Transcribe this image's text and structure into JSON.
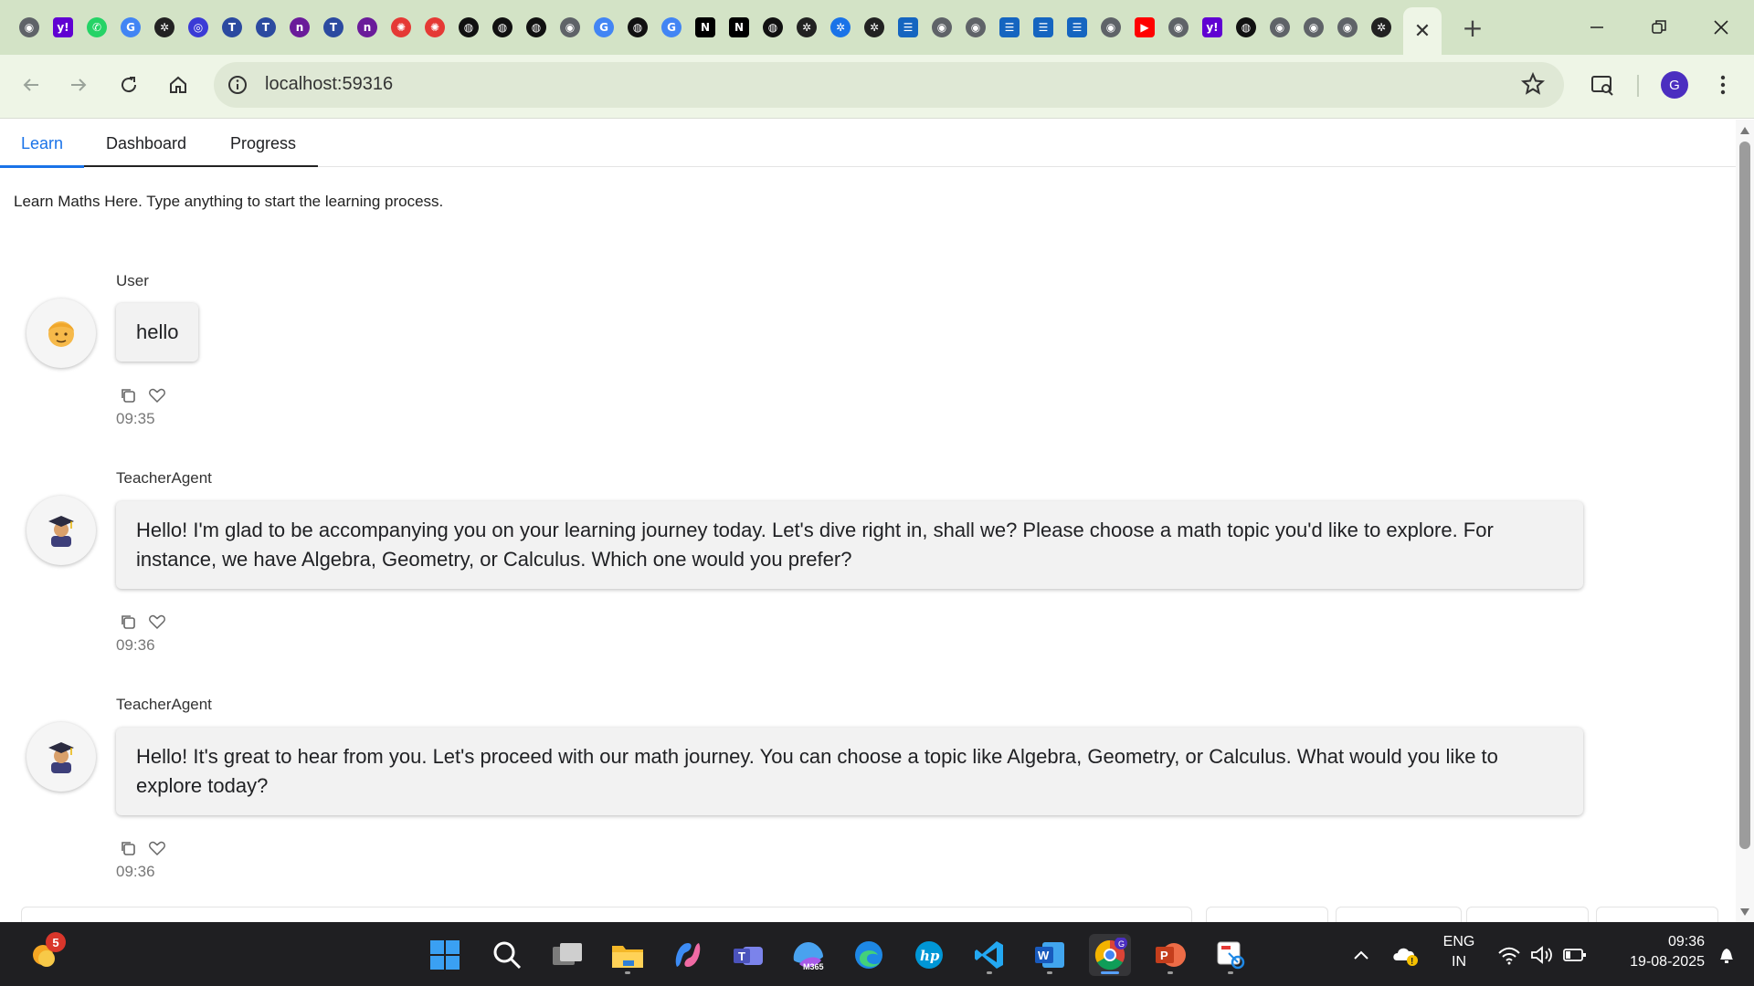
{
  "browser": {
    "url": "localhost:59316",
    "profile_initial": "G",
    "favicons": [
      {
        "icon": "chromium-icon",
        "color": "#5f6368",
        "glyph": "◉"
      },
      {
        "icon": "yahoo-icon",
        "color": "#6001d2",
        "glyph": "y!"
      },
      {
        "icon": "whatsapp-icon",
        "color": "#25d366",
        "glyph": "✆"
      },
      {
        "icon": "google-icon",
        "color": "#4285f4",
        "glyph": "G"
      },
      {
        "icon": "openai-icon",
        "color": "#222222",
        "glyph": "✲"
      },
      {
        "icon": "circle-icon",
        "color": "#3b3bd6",
        "glyph": "◎"
      },
      {
        "icon": "triv-icon",
        "color": "#2b4aa0",
        "glyph": "T"
      },
      {
        "icon": "triv-icon",
        "color": "#2b4aa0",
        "glyph": "T"
      },
      {
        "icon": "tn-icon",
        "color": "#6a1b9a",
        "glyph": "n"
      },
      {
        "icon": "triv-icon",
        "color": "#2b4aa0",
        "glyph": "T"
      },
      {
        "icon": "tn-icon",
        "color": "#6a1b9a",
        "glyph": "n"
      },
      {
        "icon": "asterisk-icon",
        "color": "#e53935",
        "glyph": "✺"
      },
      {
        "icon": "asterisk-icon",
        "color": "#e53935",
        "glyph": "✺"
      },
      {
        "icon": "github-icon",
        "color": "#111111",
        "glyph": "◍"
      },
      {
        "icon": "github-icon",
        "color": "#111111",
        "glyph": "◍"
      },
      {
        "icon": "github-icon",
        "color": "#111111",
        "glyph": "◍"
      },
      {
        "icon": "chromium-icon",
        "color": "#5f6368",
        "glyph": "◉"
      },
      {
        "icon": "google-icon",
        "color": "#4285f4",
        "glyph": "G"
      },
      {
        "icon": "github-icon",
        "color": "#111111",
        "glyph": "◍"
      },
      {
        "icon": "google-icon",
        "color": "#4285f4",
        "glyph": "G"
      },
      {
        "icon": "notion-icon",
        "color": "#000000",
        "glyph": "N"
      },
      {
        "icon": "notion-icon",
        "color": "#000000",
        "glyph": "N"
      },
      {
        "icon": "github-icon",
        "color": "#111111",
        "glyph": "◍"
      },
      {
        "icon": "openai-icon",
        "color": "#222222",
        "glyph": "✲"
      },
      {
        "icon": "openai-icon",
        "color": "#1a73e8",
        "glyph": "✲"
      },
      {
        "icon": "openai-icon",
        "color": "#222222",
        "glyph": "✲"
      },
      {
        "icon": "forms-icon",
        "color": "#1565c0",
        "glyph": "☰"
      },
      {
        "icon": "chromium-icon",
        "color": "#5f6368",
        "glyph": "◉"
      },
      {
        "icon": "chromium-icon",
        "color": "#5f6368",
        "glyph": "◉"
      },
      {
        "icon": "forms-icon",
        "color": "#1565c0",
        "glyph": "☰"
      },
      {
        "icon": "forms-icon",
        "color": "#1565c0",
        "glyph": "☰"
      },
      {
        "icon": "forms-icon",
        "color": "#1565c0",
        "glyph": "☰"
      },
      {
        "icon": "chromium-icon",
        "color": "#5f6368",
        "glyph": "◉"
      },
      {
        "icon": "youtube-icon",
        "color": "#ff0000",
        "glyph": "▶"
      },
      {
        "icon": "chromium-icon",
        "color": "#5f6368",
        "glyph": "◉"
      },
      {
        "icon": "yahoo-icon",
        "color": "#6001d2",
        "glyph": "y!"
      },
      {
        "icon": "github-icon",
        "color": "#111111",
        "glyph": "◍"
      },
      {
        "icon": "chromium-icon",
        "color": "#5f6368",
        "glyph": "◉"
      },
      {
        "icon": "chromium-icon",
        "color": "#5f6368",
        "glyph": "◉"
      },
      {
        "icon": "chromium-icon",
        "color": "#5f6368",
        "glyph": "◉"
      },
      {
        "icon": "openai-icon",
        "color": "#222222",
        "glyph": "✲"
      }
    ]
  },
  "app": {
    "tabs": [
      {
        "label": "Learn",
        "active": true
      },
      {
        "label": "Dashboard",
        "active": false
      },
      {
        "label": "Progress",
        "active": false
      }
    ],
    "intro": "Learn Maths Here. Type anything to start the learning process.",
    "accent_color": "#1a73e8"
  },
  "messages": [
    {
      "author": "User",
      "text": "hello",
      "time": "09:35",
      "avatar_icon": "user-face-icon"
    },
    {
      "author": "TeacherAgent",
      "text": "Hello! I'm glad to be accompanying you on your learning journey today. Let's dive right in, shall we? Please choose a math topic you'd like to explore. For instance, we have Algebra, Geometry, or Calculus. Which one would you prefer?",
      "time": "09:36",
      "avatar_icon": "teacher-icon"
    },
    {
      "author": "TeacherAgent",
      "text": "Hello! It's great to hear from you. Let's proceed with our math journey. You can choose a topic like Algebra, Geometry, or Calculus. What would you like to explore today?",
      "time": "09:36",
      "avatar_icon": "teacher-icon"
    }
  ],
  "taskbar": {
    "weather_badge": "5",
    "lang_line1": "ENG",
    "lang_line2": "IN",
    "time": "09:36",
    "date": "19-08-2025",
    "m365_label": "M365",
    "apps": [
      "windows-start-icon",
      "search-icon",
      "task-view-icon",
      "file-explorer-icon",
      "copilot-icon",
      "teams-icon",
      "m365-icon",
      "edge-icon",
      "hp-icon",
      "vscode-icon",
      "word-icon",
      "chrome-icon",
      "powerpoint-icon",
      "snipping-tool-icon"
    ]
  }
}
